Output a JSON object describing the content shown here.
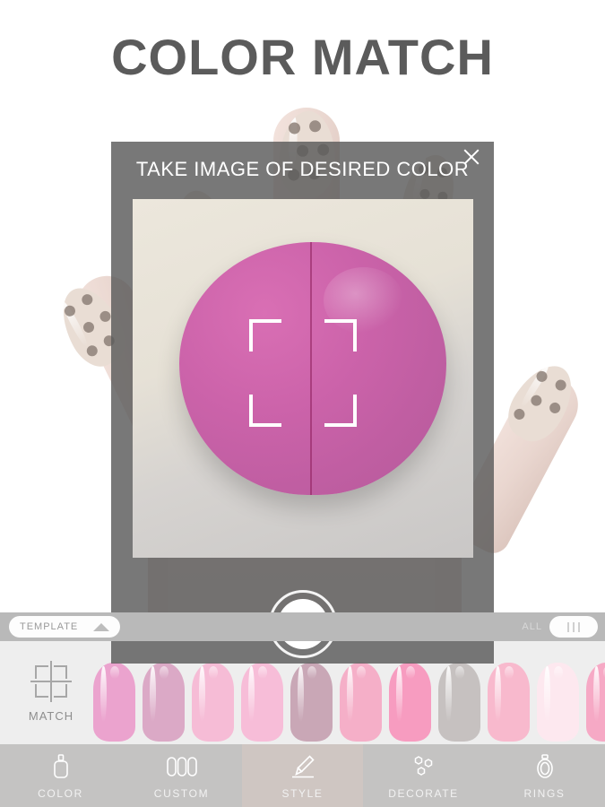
{
  "app": {
    "title": "COLOR MATCH"
  },
  "modal": {
    "heading": "TAKE IMAGE OF DESIRED COLOR",
    "close_icon": "close-icon",
    "shutter_icon": "camera-shutter-icon",
    "focus_icon": "focus-bracket-icon",
    "preview_subject_color": "#cc63aa",
    "overlay_color": "#5a5a5a"
  },
  "strip": {
    "template_label": "TEMPLATE",
    "template_arrow_icon": "chevron-up-icon",
    "all_label": "ALL",
    "all_toggle_icon": "three-bars-icon"
  },
  "rail": {
    "match_label": "MATCH",
    "match_icon": "crosshair-bracket-icon",
    "swatches": [
      {
        "name": "swatch-1",
        "color": "#eba3ce"
      },
      {
        "name": "swatch-2",
        "color": "#dba9c6"
      },
      {
        "name": "swatch-3",
        "color": "#f6bcd6"
      },
      {
        "name": "swatch-4",
        "color": "#f7bdd8"
      },
      {
        "name": "swatch-5",
        "color": "#c9a7b6"
      },
      {
        "name": "swatch-6",
        "color": "#f5afc8"
      },
      {
        "name": "swatch-7",
        "color": "#f79cc0"
      },
      {
        "name": "swatch-8",
        "color": "#c6c1c0"
      },
      {
        "name": "swatch-9",
        "color": "#f8b9cd"
      },
      {
        "name": "swatch-10",
        "color": "#fde8ef"
      },
      {
        "name": "swatch-11",
        "color": "#f6a9c5"
      }
    ]
  },
  "tabbar": {
    "items": [
      {
        "label": "COLOR",
        "icon": "nail-polish-bottle-icon",
        "active": false
      },
      {
        "label": "CUSTOM",
        "icon": "three-nails-icon",
        "active": false
      },
      {
        "label": "STYLE",
        "icon": "brush-icon",
        "active": true
      },
      {
        "label": "DECORATE",
        "icon": "gems-icon",
        "active": false
      },
      {
        "label": "RINGS",
        "icon": "ring-icon",
        "active": false
      }
    ]
  }
}
